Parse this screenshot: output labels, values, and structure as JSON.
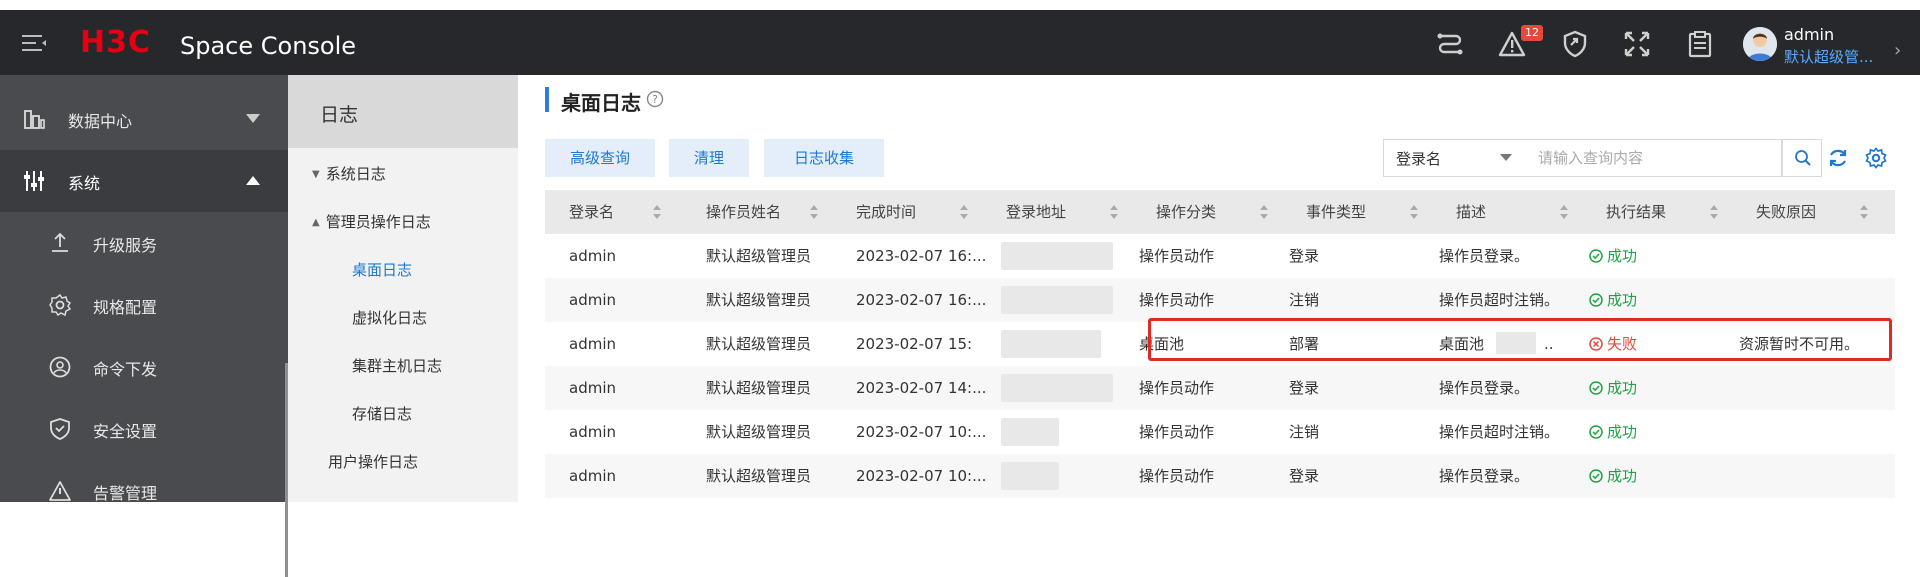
{
  "topbar": {
    "logo_text": "H3C",
    "app_title": "Space Console",
    "alarm_badge": "12",
    "user_name": "admin",
    "user_role": "默认超级管..."
  },
  "sidebar": {
    "items": [
      {
        "label": "数据中心",
        "icon": "datacenter-icon"
      },
      {
        "label": "系统",
        "icon": "system-sliders-icon"
      },
      {
        "label": "升级服务",
        "icon": "upgrade-icon"
      },
      {
        "label": "规格配置",
        "icon": "gear-icon"
      },
      {
        "label": "命令下发",
        "icon": "command-icon"
      },
      {
        "label": "安全设置",
        "icon": "shield-icon"
      },
      {
        "label": "告警管理",
        "icon": "warning-icon"
      }
    ]
  },
  "subnav": {
    "header": "日志",
    "items": [
      {
        "label": "系统日志"
      },
      {
        "label": "管理员操作日志"
      },
      {
        "label": "桌面日志"
      },
      {
        "label": "虚拟化日志"
      },
      {
        "label": "集群主机日志"
      },
      {
        "label": "存储日志"
      },
      {
        "label": "用户操作日志"
      }
    ]
  },
  "main": {
    "title": "桌面日志",
    "buttons": {
      "advanced_query": "高级查询",
      "clear": "清理",
      "collect": "日志收集"
    },
    "search": {
      "field": "登录名",
      "placeholder": "请输入查询内容"
    }
  },
  "table": {
    "columns": [
      "登录名",
      "操作员姓名",
      "完成时间",
      "登录地址",
      "操作分类",
      "事件类型",
      "描述",
      "执行结果",
      "失败原因"
    ],
    "rows": [
      {
        "login": "admin",
        "operator": "默认超级管理员",
        "time": "2023-02-07 16:...",
        "address": "",
        "category": "操作员动作",
        "event": "登录",
        "desc": "操作员登录。",
        "result": "成功",
        "reason": ""
      },
      {
        "login": "admin",
        "operator": "默认超级管理员",
        "time": "2023-02-07 16:...",
        "address": "",
        "category": "操作员动作",
        "event": "注销",
        "desc": "操作员超时注销。",
        "result": "成功",
        "reason": ""
      },
      {
        "login": "admin",
        "operator": "默认超级管理员",
        "time": "2023-02-07 15:",
        "address": "",
        "category": "桌面池",
        "event": "部署",
        "desc": "桌面池",
        "desc_suffix": "..",
        "result": "失败",
        "reason": "资源暂时不可用。"
      },
      {
        "login": "admin",
        "operator": "默认超级管理员",
        "time": "2023-02-07 14:...",
        "address": "",
        "category": "操作员动作",
        "event": "登录",
        "desc": "操作员登录。",
        "result": "成功",
        "reason": ""
      },
      {
        "login": "admin",
        "operator": "默认超级管理员",
        "time": "2023-02-07 10:...",
        "address": "",
        "category": "操作员动作",
        "event": "注销",
        "desc": "操作员超时注销。",
        "result": "成功",
        "reason": ""
      },
      {
        "login": "admin",
        "operator": "默认超级管理员",
        "time": "2023-02-07 10:...",
        "address": "",
        "category": "操作员动作",
        "event": "登录",
        "desc": "操作员登录。",
        "result": "成功",
        "reason": ""
      }
    ]
  },
  "colors": {
    "accent": "#1f78d1",
    "success": "#22a045",
    "failure": "#e5483d",
    "topbar": "#26282c",
    "sidebar": "#4a4b4f"
  }
}
